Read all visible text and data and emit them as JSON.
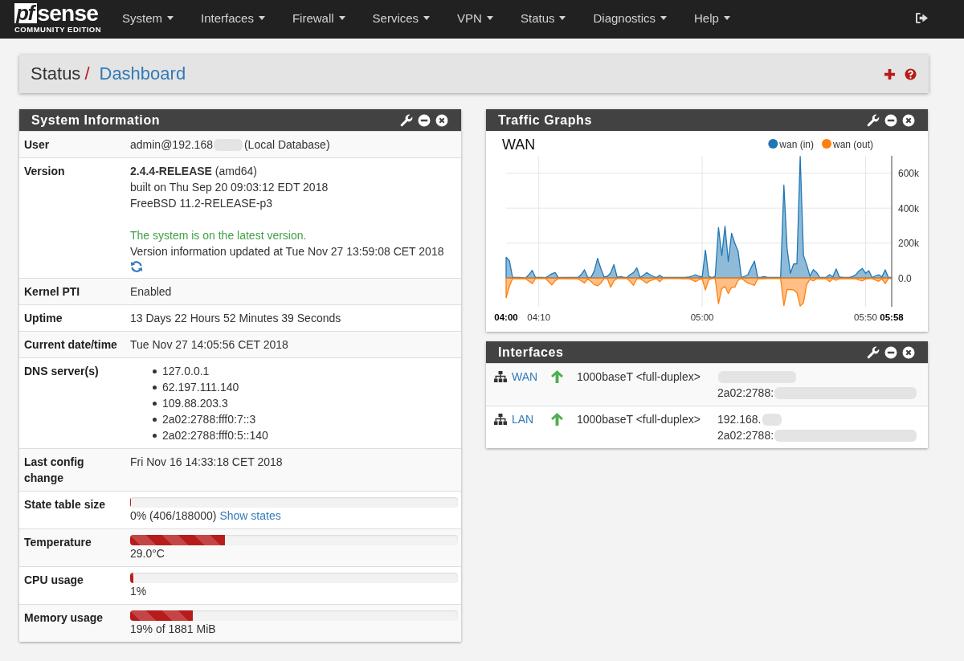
{
  "navbar": {
    "logo": {
      "mark": "pf",
      "name": "sense",
      "edition": "COMMUNITY EDITION"
    },
    "menus": [
      "System",
      "Interfaces",
      "Firewall",
      "Services",
      "VPN",
      "Status",
      "Diagnostics",
      "Help"
    ]
  },
  "breadcrumb": {
    "section": "Status",
    "separator": "/",
    "page": "Dashboard"
  },
  "columns": [
    [
      {
        "kind": "system_information",
        "title": "System Information",
        "rows": [
          {
            "kind": "masked",
            "label": "User",
            "segments": [
              {
                "text": "admin@192.168",
                "redacted": true
              },
              {
                "text": "(Local Database)",
                "redacted": false
              }
            ]
          },
          {
            "kind": "version",
            "label": "Version",
            "lines": [
              "**2.4.4-RELEASE** (amd64)",
              "built on Thu Sep 20 09:03:12 EDT 2018",
              "FreeBSD 11.2-RELEASE-p3"
            ],
            "status": "The system is on the latest version.",
            "updated": "Version information updated at Tue Nov 27 13:59:08 CET 2018"
          },
          {
            "kind": "text",
            "label": "Kernel PTI",
            "value": "Enabled"
          },
          {
            "kind": "text",
            "label": "Uptime",
            "value": "13 Days 22 Hours 52 Minutes 39 Seconds"
          },
          {
            "kind": "text",
            "label": "Current date/time",
            "value": "Tue Nov 27 14:05:56 CET 2018"
          },
          {
            "kind": "list",
            "label": "DNS server(s)",
            "items": [
              "127.0.0.1",
              "62.197.111.140",
              "109.88.203.3",
              "2a02:2788:fff0:7::3",
              "2a02:2788:fff0:5::140"
            ]
          },
          {
            "kind": "text",
            "label": "Last config change",
            "value": "Fri Nov 16 14:33:18 CET 2018"
          },
          {
            "kind": "meter",
            "label": "State table size",
            "level": 0,
            "reading": "0% (406/188000)",
            "link": "Show states"
          },
          {
            "kind": "meter",
            "label": "Temperature",
            "level": 0.29,
            "reading": "29.0°C"
          },
          {
            "kind": "meter",
            "label": "CPU usage",
            "level": 0.01,
            "reading": "1%"
          },
          {
            "kind": "meter",
            "label": "Memory usage",
            "level": 0.19,
            "reading": "19% of 1881 MiB"
          }
        ]
      }
    ],
    [
      {
        "kind": "traffic_graphs",
        "title": "Traffic Graphs",
        "chart_data": {
          "type": "area",
          "title": "WAN",
          "grid": true,
          "legend": "top-right",
          "categories": [
            "04:00",
            null,
            null,
            null,
            null,
            null,
            null,
            null,
            null,
            null,
            "04:10",
            null,
            null,
            null,
            null,
            null,
            null,
            null,
            null,
            null,
            null,
            null,
            null,
            null,
            null,
            null,
            null,
            null,
            null,
            null,
            null,
            null,
            null,
            null,
            null,
            null,
            null,
            null,
            null,
            null,
            null,
            null,
            null,
            null,
            null,
            null,
            null,
            null,
            null,
            null,
            null,
            null,
            null,
            null,
            null,
            null,
            null,
            null,
            null,
            null,
            "05:00",
            null,
            null,
            null,
            null,
            null,
            null,
            null,
            null,
            null,
            null,
            null,
            null,
            null,
            null,
            null,
            null,
            null,
            null,
            null,
            null,
            null,
            null,
            null,
            null,
            null,
            null,
            null,
            null,
            null,
            null,
            null,
            null,
            null,
            null,
            null,
            null,
            null,
            null,
            null,
            null,
            null,
            null,
            null,
            null,
            null,
            null,
            null,
            null,
            null,
            "05:50",
            null,
            null,
            null,
            null,
            null,
            null,
            null,
            "05:58"
          ],
          "ylim": [
            -165000,
            700000
          ],
          "yticks": [
            {
              "value": 0,
              "label": "0.0"
            },
            {
              "value": 200000,
              "label": "200k"
            },
            {
              "value": 400000,
              "label": "400k"
            },
            {
              "value": 600000,
              "label": "600k"
            }
          ],
          "series": [
            {
              "name": "wan (in)",
              "color": "#1f77b4",
              "values": [
                119000,
                98000,
                3000,
                3000,
                3000,
                2000,
                0,
                20000,
                44000,
                3000,
                3000,
                3000,
                2000,
                12000,
                24000,
                31000,
                2000,
                3000,
                3000,
                3000,
                3000,
                3000,
                3000,
                20000,
                47000,
                3000,
                5000,
                40000,
                113000,
                52000,
                6000,
                10000,
                29000,
                77000,
                3000,
                8000,
                5000,
                3000,
                20000,
                31000,
                58000,
                3000,
                15000,
                31000,
                19000,
                10000,
                3000,
                15000,
                3000,
                3000,
                3000,
                3000,
                3000,
                3000,
                4000,
                5000,
                6000,
                12000,
                19000,
                10000,
                6000,
                160000,
                10000,
                3000,
                10000,
                289000,
                129000,
                297000,
                95000,
                256000,
                200000,
                152000,
                3000,
                10000,
                19000,
                60000,
                97000,
                3000,
                5000,
                8000,
                3000,
                3000,
                3000,
                3000,
                3000,
                532000,
                168000,
                27000,
                81000,
                81000,
                697000,
                129000,
                76000,
                10000,
                48000,
                32000,
                3000,
                4000,
                5000,
                19000,
                6000,
                52000,
                6000,
                5000,
                4000,
                3000,
                8000,
                19000,
                40000,
                55000,
                27000,
                42000,
                3000,
                12000,
                19000,
                6000,
                47000,
                3000,
                3000
              ]
            },
            {
              "name": "wan (out)",
              "color": "#ff7f0e",
              "values": [
                -113000,
                -48000,
                -3000,
                -4000,
                -5000,
                -5000,
                -5000,
                -18000,
                -32000,
                -3000,
                -3000,
                -3000,
                -3000,
                -20000,
                -40000,
                -16000,
                -3000,
                -4000,
                -4000,
                -5000,
                -5000,
                -5000,
                -5000,
                -17000,
                -29000,
                -5000,
                -20000,
                -38000,
                -45000,
                -29000,
                -3000,
                -3000,
                -53000,
                -16000,
                -3000,
                -3000,
                -3000,
                -3000,
                -20000,
                -42000,
                -5000,
                -5000,
                -15000,
                -29000,
                -16000,
                -10000,
                -3000,
                -21000,
                -3000,
                -3000,
                -3000,
                -3000,
                -3000,
                -3000,
                -4000,
                -4000,
                -5000,
                -12000,
                -21000,
                -10000,
                -5000,
                -69000,
                -10000,
                -3000,
                -3000,
                -147000,
                -61000,
                -48000,
                -89000,
                -53000,
                -53000,
                -13000,
                -3000,
                -15000,
                -29000,
                -36000,
                -42000,
                -5000,
                -5000,
                -5000,
                -3000,
                -3000,
                -3000,
                -3000,
                -3000,
                -158000,
                -66000,
                -65000,
                -69000,
                -85000,
                -161000,
                -142000,
                -37000,
                -8000,
                -16000,
                -5000,
                -5000,
                -5000,
                -5000,
                -21000,
                -5000,
                -13000,
                -5000,
                -4000,
                -4000,
                -3000,
                -4000,
                -5000,
                -12000,
                -16000,
                -6000,
                -3000,
                -3000,
                -12000,
                -19000,
                -5000,
                -32000,
                -3000,
                -3000
              ]
            }
          ]
        }
      },
      {
        "kind": "interfaces",
        "title": "Interfaces",
        "rows": [
          {
            "name": "WAN",
            "up": true,
            "media": "1000baseT <full-duplex>",
            "addresses": [
              {
                "redacted": true
              },
              {
                "text": "2a02:2788:",
                "redacted": true
              }
            ]
          },
          {
            "name": "LAN",
            "up": true,
            "media": "1000baseT <full-duplex>",
            "addresses": [
              {
                "text": "192.168.",
                "redacted": true
              },
              {
                "text": "2a02:2788:",
                "redacted": true
              }
            ]
          }
        ]
      }
    ]
  ]
}
